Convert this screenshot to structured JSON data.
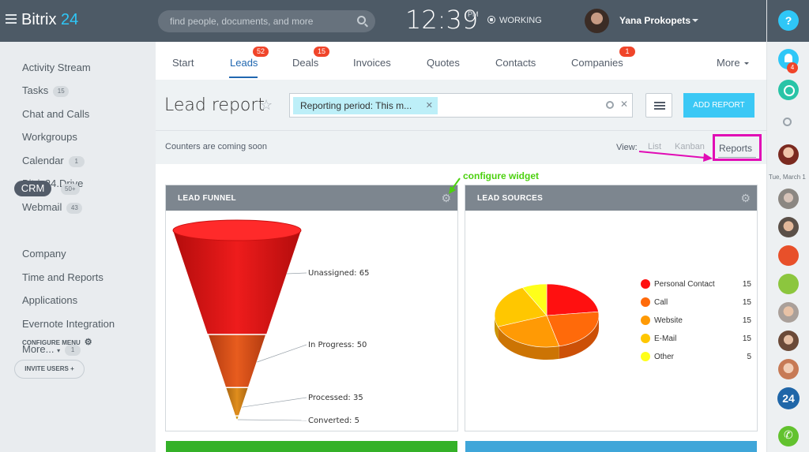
{
  "app": {
    "logo_text": "Bitrix",
    "logo_num": "24",
    "search_placeholder": "find people, documents, and more",
    "clock": "12:39",
    "ampm": "PM",
    "work_status": "WORKING",
    "user_name": "Yana Prokopets"
  },
  "sidebar": {
    "items": [
      {
        "label": "Activity Stream"
      },
      {
        "label": "Tasks",
        "badge": "15"
      },
      {
        "label": "Chat and Calls"
      },
      {
        "label": "Workgroups"
      },
      {
        "label": "Calendar",
        "badge": "1"
      },
      {
        "label": "Bitrix24.Drive"
      },
      {
        "label": "Webmail",
        "badge": "43"
      },
      {
        "label": "CRM",
        "badge": "50+"
      },
      {
        "label": "Company"
      },
      {
        "label": "Time and Reports"
      },
      {
        "label": "Applications"
      },
      {
        "label": "Evernote Integration"
      },
      {
        "label": "More...",
        "badge": "1"
      }
    ],
    "configure_menu": "CONFIGURE MENU",
    "invite_users": "INVITE USERS"
  },
  "tabs": [
    {
      "label": "Start"
    },
    {
      "label": "Leads",
      "counter": "52"
    },
    {
      "label": "Deals",
      "counter": "15"
    },
    {
      "label": "Invoices"
    },
    {
      "label": "Quotes"
    },
    {
      "label": "Contacts"
    },
    {
      "label": "Companies",
      "counter": "1"
    },
    {
      "label": "More"
    }
  ],
  "header": {
    "title": "Lead report",
    "filter_chip": "Reporting period: This m...",
    "add_report": "ADD REPORT"
  },
  "subbar": {
    "counters_text": "Counters are coming soon",
    "view_label": "View:",
    "view_options": [
      "List",
      "Kanban",
      "Reports"
    ]
  },
  "annotation": {
    "configure_widget": "configure widget"
  },
  "rightbar": {
    "help": "?",
    "notifications": "4",
    "date": "Tue, March 1",
    "logo_24": "24"
  },
  "widgets": {
    "funnel_title": "LEAD FUNNEL",
    "sources_title": "LEAD SOURCES"
  },
  "chart_data": [
    {
      "type": "funnel",
      "title": "LEAD FUNNEL",
      "categories": [
        "Unassigned",
        "In Progress",
        "Processed",
        "Converted"
      ],
      "values": [
        65,
        50,
        35,
        5
      ],
      "labels": [
        "Unassigned: 65",
        "In Progress: 50",
        "Processed: 35",
        "Converted: 5"
      ],
      "colors": [
        "#e11e1e",
        "#e0551a",
        "#dd8a1a",
        "#d49a1a"
      ]
    },
    {
      "type": "pie",
      "title": "LEAD SOURCES",
      "categories": [
        "Personal Contact",
        "Call",
        "Website",
        "E-Mail",
        "Other"
      ],
      "values": [
        15,
        15,
        15,
        15,
        5
      ],
      "colors": [
        "#ff1010",
        "#ff6a0a",
        "#ff9a05",
        "#ffc700",
        "#ffff1a"
      ]
    }
  ]
}
